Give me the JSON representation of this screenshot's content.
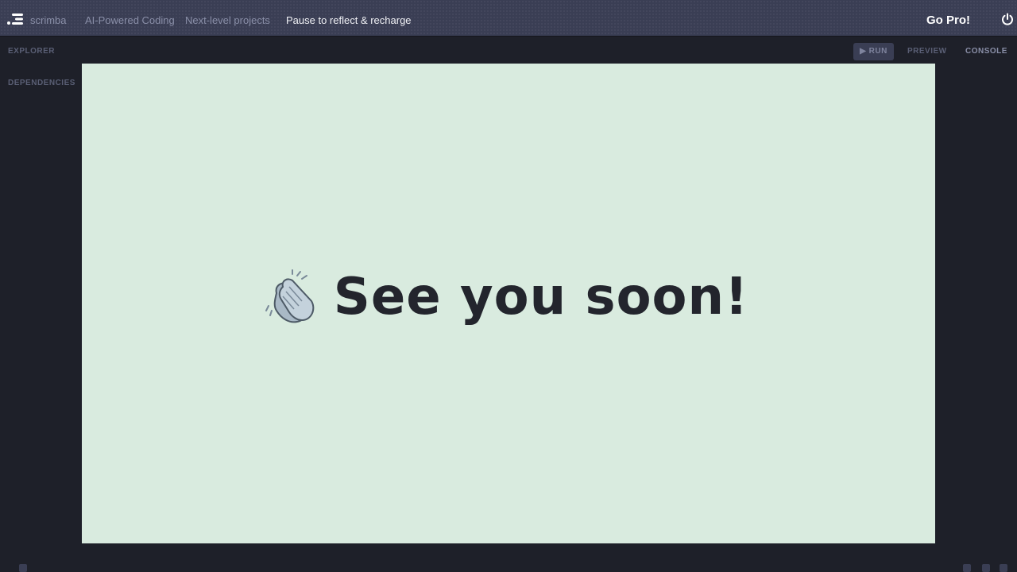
{
  "header": {
    "brand": "scrimba",
    "breadcrumbs": [
      {
        "label": "AI-Powered Coding",
        "active": false
      },
      {
        "label": "Next-level projects",
        "active": false
      },
      {
        "label": "Pause to reflect & recharge",
        "active": true
      }
    ],
    "go_pro_label": "Go Pro!",
    "power_icon": "power-icon"
  },
  "sidebar": {
    "explorer_label": "EXPLORER",
    "dependencies_label": "DEPENDENCIES"
  },
  "toolbar": {
    "run_label": "▶ RUN",
    "preview_label": "PREVIEW",
    "console_label": "CONSOLE"
  },
  "preview": {
    "headline": "See you soon!",
    "emoji_icon": "clapping-hands-icon",
    "background": "#d9ebdf"
  },
  "colors": {
    "topbar": "#3a3e54",
    "editor_bg": "#1e2029",
    "text_dark": "#23252d"
  }
}
